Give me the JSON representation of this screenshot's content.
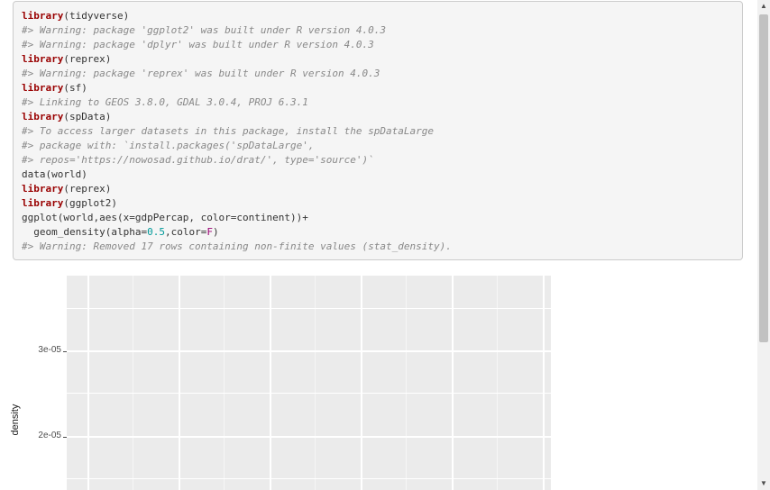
{
  "code_lines": [
    [
      {
        "t": "library",
        "c": "kw"
      },
      {
        "t": "(tidyverse)"
      }
    ],
    [
      {
        "t": "#> Warning: package 'ggplot2' was built under R version 4.0.3",
        "c": "cmt"
      }
    ],
    [
      {
        "t": "#> Warning: package 'dplyr' was built under R version 4.0.3",
        "c": "cmt"
      }
    ],
    [
      {
        "t": "library",
        "c": "kw"
      },
      {
        "t": "(reprex)"
      }
    ],
    [
      {
        "t": "#> Warning: package 'reprex' was built under R version 4.0.3",
        "c": "cmt"
      }
    ],
    [
      {
        "t": "library",
        "c": "kw"
      },
      {
        "t": "(sf)"
      }
    ],
    [
      {
        "t": "#> Linking to GEOS 3.8.0, GDAL 3.0.4, PROJ 6.3.1",
        "c": "cmt"
      }
    ],
    [
      {
        "t": "library",
        "c": "kw"
      },
      {
        "t": "(spData)"
      }
    ],
    [
      {
        "t": "#> To access larger datasets in this package, install the spDataLarge",
        "c": "cmt"
      }
    ],
    [
      {
        "t": "#> package with: `install.packages('spDataLarge',",
        "c": "cmt"
      }
    ],
    [
      {
        "t": "#> repos='https://nowosad.github.io/drat/', type='source')`",
        "c": "cmt"
      }
    ],
    [
      {
        "t": "data(world)"
      }
    ],
    [
      {
        "t": "library",
        "c": "kw"
      },
      {
        "t": "(reprex)"
      }
    ],
    [
      {
        "t": "library",
        "c": "kw"
      },
      {
        "t": "(ggplot2)"
      }
    ],
    [
      {
        "t": "ggplot(world,aes(x=gdpPercap, color=continent))+"
      }
    ],
    [
      {
        "t": "  geom_density(alpha="
      },
      {
        "t": "0.5",
        "c": "num"
      },
      {
        "t": ",color="
      },
      {
        "t": "F",
        "c": "const"
      },
      {
        "t": ")"
      }
    ],
    [
      {
        "t": "#> Warning: Removed 17 rows containing non-finite values (stat_density).",
        "c": "cmt"
      }
    ]
  ],
  "plot": {
    "ylabel": "density",
    "yticks": [
      {
        "label": "3e-05",
        "value": 3e-05
      },
      {
        "label": "2e-05",
        "value": 2e-05
      }
    ]
  },
  "colors": {
    "panel_bg": "#ebebeb",
    "grid": "#ffffff",
    "keyword": "#990000",
    "comment": "#888888",
    "number": "#009999",
    "constant": "#990073"
  }
}
